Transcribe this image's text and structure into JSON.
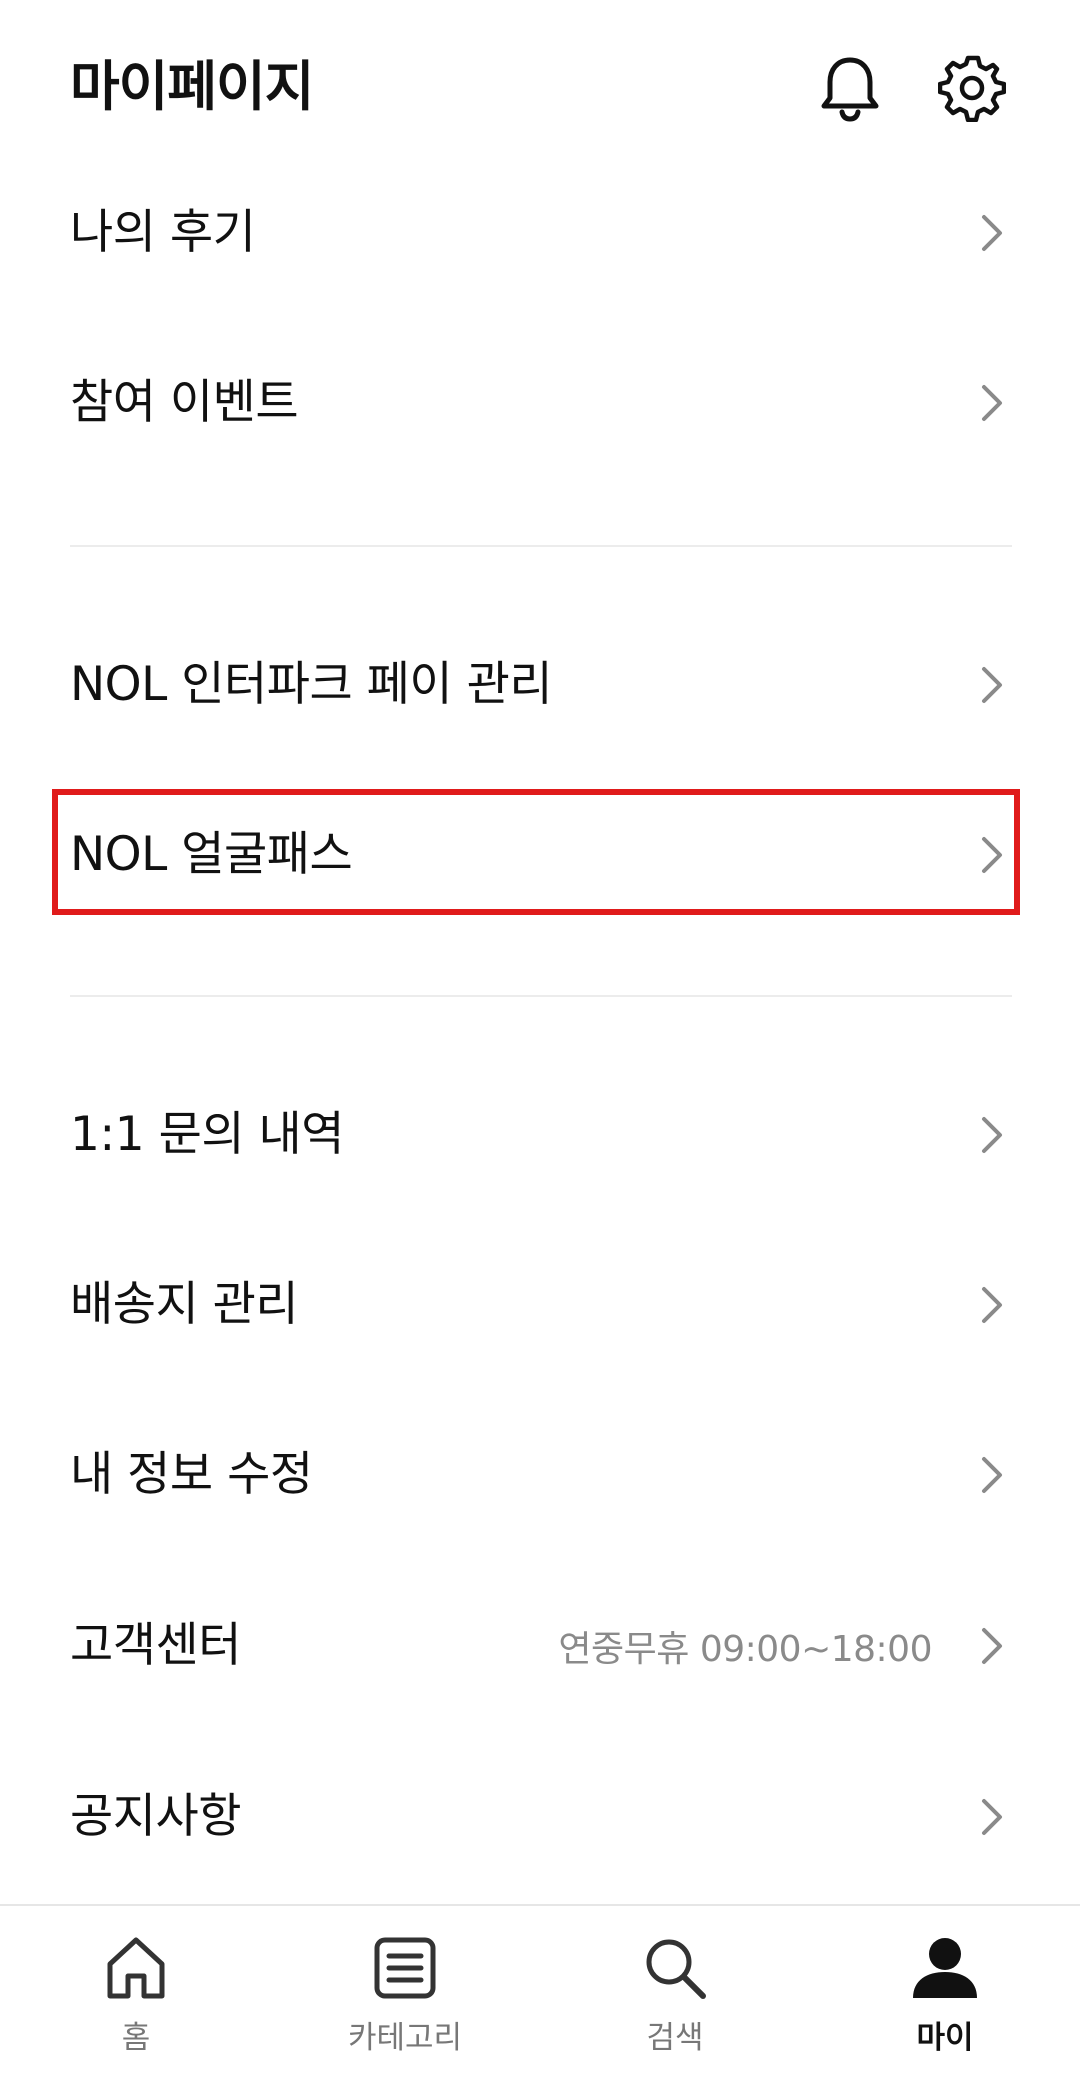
{
  "header": {
    "title": "마이페이지",
    "icons": [
      "bell-icon",
      "gear-icon"
    ]
  },
  "menu": {
    "reviews": "나의 후기",
    "events": "참여 이벤트",
    "pay_manage": "NOL 인터파크 페이 관리",
    "face_pass": "NOL 얼굴패스",
    "inquiry": "1:1 문의 내역",
    "address": "배송지 관리",
    "edit_profile": "내 정보 수정",
    "customer_center": "고객센터",
    "customer_center_hours": "연중무휴 09:00~18:00",
    "notices": "공지사항"
  },
  "bottom_nav": {
    "home": "홈",
    "category": "카테고리",
    "search": "검색",
    "my": "마이",
    "active": "my"
  },
  "colors": {
    "highlight": "#e01b1b",
    "text": "#111111",
    "muted": "#8a8a8a"
  }
}
